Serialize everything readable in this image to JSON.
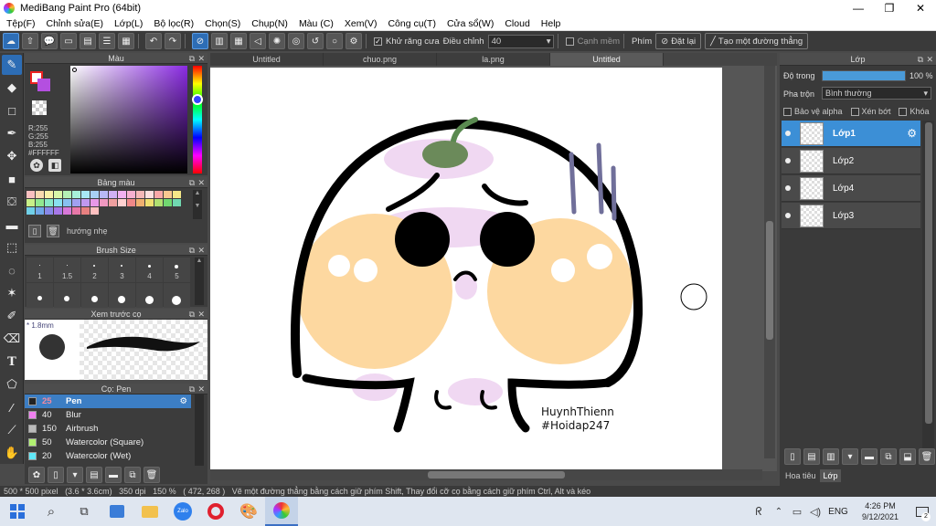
{
  "window": {
    "title": "MediBang Paint Pro (64bit)",
    "min_glyph": "—",
    "max_glyph": "❐",
    "close_glyph": "✕"
  },
  "menu": [
    "Tệp(F)",
    "Chỉnh sửa(E)",
    "Lớp(L)",
    "Bộ lọc(R)",
    "Chọn(S)",
    "Chụp(N)",
    "Màu (C)",
    "Xem(V)",
    "Công cụ(T)",
    "Cửa sổ(W)",
    "Cloud",
    "Help"
  ],
  "toolbar": {
    "antialias_label": "Khử răng cưa",
    "adjust_label": "Điều chỉnh",
    "adjust_value": "40",
    "edge_label": "Cạnh mềm",
    "key_label": "Phím",
    "reset_label": "Đặt lại",
    "straight_label": "Tạo một đường thẳng"
  },
  "color_panel": {
    "title": "Màu",
    "r": "R:255",
    "g": "G:255",
    "b": "B:255",
    "hex": "#FFFFFF",
    "primary_color": "#ffffff",
    "secondary_color": "#b44fe0"
  },
  "swatch_panel": {
    "title": "Bảng màu",
    "hint": "hướng nhẹ",
    "colors": [
      "#f9c0c0",
      "#f9d9b0",
      "#f9f0a8",
      "#d9f5a8",
      "#b5f0b5",
      "#a8f0d9",
      "#a8e8f5",
      "#a8d0f5",
      "#b8b8f5",
      "#d0b0f5",
      "#f0b0f0",
      "#f5b0d0",
      "#f5b8b8",
      "#ffe0e0",
      "#f9a8a8",
      "#f9c890",
      "#f5e888",
      "#c8f088",
      "#90e890",
      "#88e8c8",
      "#88e0f0",
      "#88c0f0",
      "#a0a0f0",
      "#c098f0",
      "#e898e8",
      "#f098c0",
      "#f0a0a0",
      "#ffd0d0",
      "#f08888",
      "#f0b070",
      "#f0e070",
      "#b0e070",
      "#70d870",
      "#70d8b0",
      "#70d0e8",
      "#70a8e8",
      "#8888e8",
      "#a878e8",
      "#d878d8",
      "#e878a8",
      "#e88080",
      "#ffc0c0"
    ]
  },
  "brush_size_panel": {
    "title": "Brush Size",
    "sizes": [
      "1",
      "1.5",
      "2",
      "3",
      "4",
      "5"
    ]
  },
  "preview_panel": {
    "title": "Xem trước cọ",
    "size": "1.8mm"
  },
  "brush_panel": {
    "title": "Cọ: Pen",
    "items": [
      {
        "size": "25",
        "name": "Pen",
        "color": "#222222"
      },
      {
        "size": "40",
        "name": "Blur",
        "color": "#f080f0"
      },
      {
        "size": "150",
        "name": "Airbrush",
        "color": "#bbbbbb"
      },
      {
        "size": "50",
        "name": "Watercolor (Square)",
        "color": "#b0f070"
      },
      {
        "size": "20",
        "name": "Watercolor (Wet)",
        "color": "#60e8f8"
      }
    ]
  },
  "doc_tabs": [
    "Untitled",
    "chuo.png",
    "la.png",
    "Untitled"
  ],
  "canvas_text": {
    "line1": "HuynhThienn",
    "line2": "#Hoidap247"
  },
  "layer_panel": {
    "title": "Lớp",
    "opacity_label": "Độ trong",
    "opacity_value": "100 %",
    "opacity_fraction": 1.0,
    "blend_label": "Pha trộn",
    "blend_value": "Bình thường",
    "protect_alpha": "Bảo vệ alpha",
    "clipping": "Xén bớt",
    "lock": "Khóa",
    "layers": [
      "Lớp1",
      "Lớp2",
      "Lớp4",
      "Lớp3"
    ],
    "tab_left": "Hoa tiêu",
    "tab_right": "Lớp"
  },
  "statusbar": {
    "size": "500 * 500 pixel",
    "cm": "(3.6 * 3.6cm)",
    "dpi": "350 dpi",
    "zoom": "150 %",
    "coords": "( 472, 268 )",
    "hint": "Vẽ một đường thẳng bằng cách giữ phím Shift, Thay đổi cỡ cọ bằng cách giữ phím Ctrl, Alt và kéo"
  },
  "taskbar": {
    "lang": "ENG",
    "time": "4:26 PM",
    "date": "9/12/2021",
    "notif_count": "2",
    "zalo": "Zalo"
  }
}
